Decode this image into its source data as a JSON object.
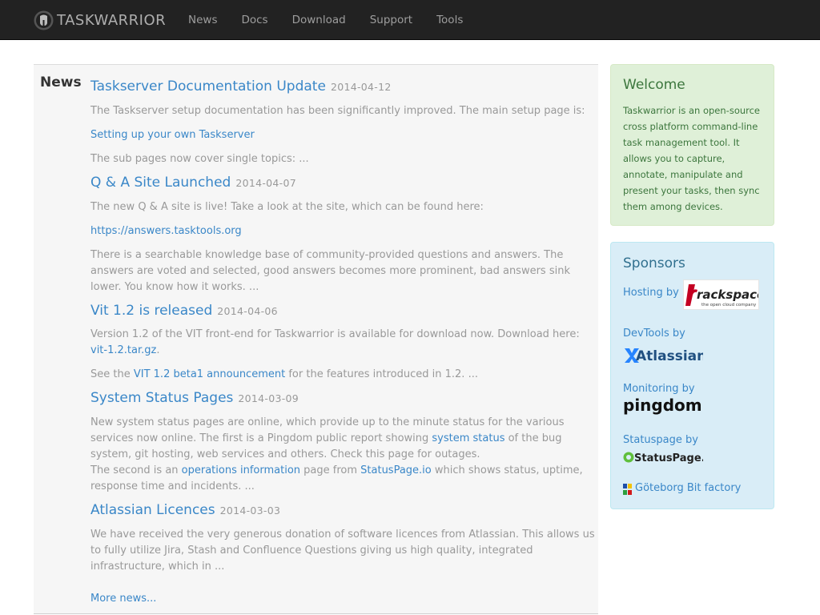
{
  "brand": {
    "name": "TASKWARRIOR"
  },
  "nav": [
    "News",
    "Docs",
    "Download",
    "Support",
    "Tools"
  ],
  "news": {
    "heading": "News",
    "articles": [
      {
        "title": "Taskserver Documentation Update",
        "date": "2014-04-12"
      },
      {
        "title": "Q & A Site Launched",
        "date": "2014-04-07"
      },
      {
        "title": "Vit 1.2 is released",
        "date": "2014-04-06"
      },
      {
        "title": "System Status Pages",
        "date": "2014-03-09"
      },
      {
        "title": "Atlassian Licences",
        "date": "2014-03-03"
      }
    ],
    "a0": {
      "p1": "The Taskserver setup documentation has been significantly improved. The main setup page is:",
      "link": "Setting up your own Taskserver",
      "p2": "The sub pages now cover single topics: ..."
    },
    "a1": {
      "p1": "The new Q & A site is live! Take a look at the site, which can be found here:",
      "link": "https://answers.tasktools.org",
      "p2": "There is a searchable knowledge base of community-provided questions and answers. The answers are voted and selected, good answers becomes more prominent, bad answers sink lower. You know how it works. ..."
    },
    "a2": {
      "p1": "Version 1.2 of the VIT front-end for Taskwarrior is available for download now. Download here:",
      "link1": "vit-1.2.tar.gz",
      "p1_end": ".",
      "p2_start": "See the ",
      "link2": "VIT 1.2 beta1 announcement",
      "p2_end": " for the features introduced in 1.2. ..."
    },
    "a3": {
      "t1": "New system status pages are online, which provide up to the minute status for the various services now online. The first is a Pingdom public report showing ",
      "link1": "system status",
      "t2": " of the bug system, git hosting, web services and others. Check this page for outages.",
      "t3": "The second is an ",
      "link2": "operations information",
      "t4": " page from ",
      "link3": "StatusPage.io",
      "t5": " which shows status, uptime, response time and incidents. ..."
    },
    "a4": {
      "p1": "We have received the very generous donation of software licences from Atlassian. This allows us to fully utilize Jira, Stash and Confluence Questions giving us high quality, integrated infrastructure, which in ..."
    },
    "more": "More news..."
  },
  "welcome": {
    "title": "Welcome",
    "text": "Taskwarrior is an open-source cross platform command-line task management tool. It allows you to capture, annotate, manipulate and present your tasks, then sync them among devices."
  },
  "sponsors": {
    "title": "Sponsors",
    "hosting": "Hosting by",
    "rackspace": {
      "name": "rackspace.",
      "tagline": "the open cloud company"
    },
    "devtools": "DevTools by",
    "atlassian": "Atlassian",
    "monitoring": "Monitoring by",
    "pingdom": "pingdom",
    "statuspage_label": "Statuspage by",
    "statuspage": "StatusPage.io",
    "goteborg": "Göteborg Bit factory"
  },
  "colors": {
    "navbar": "#222222",
    "link": "#3a87c8",
    "welcome_bg": "#dff0d8",
    "welcome_text": "#3c763d",
    "sponsors_bg": "#d9edf7",
    "sponsors_title": "#31708f",
    "rackspace_red": "#c40022",
    "statuspage_green": "#5fbf3c"
  }
}
